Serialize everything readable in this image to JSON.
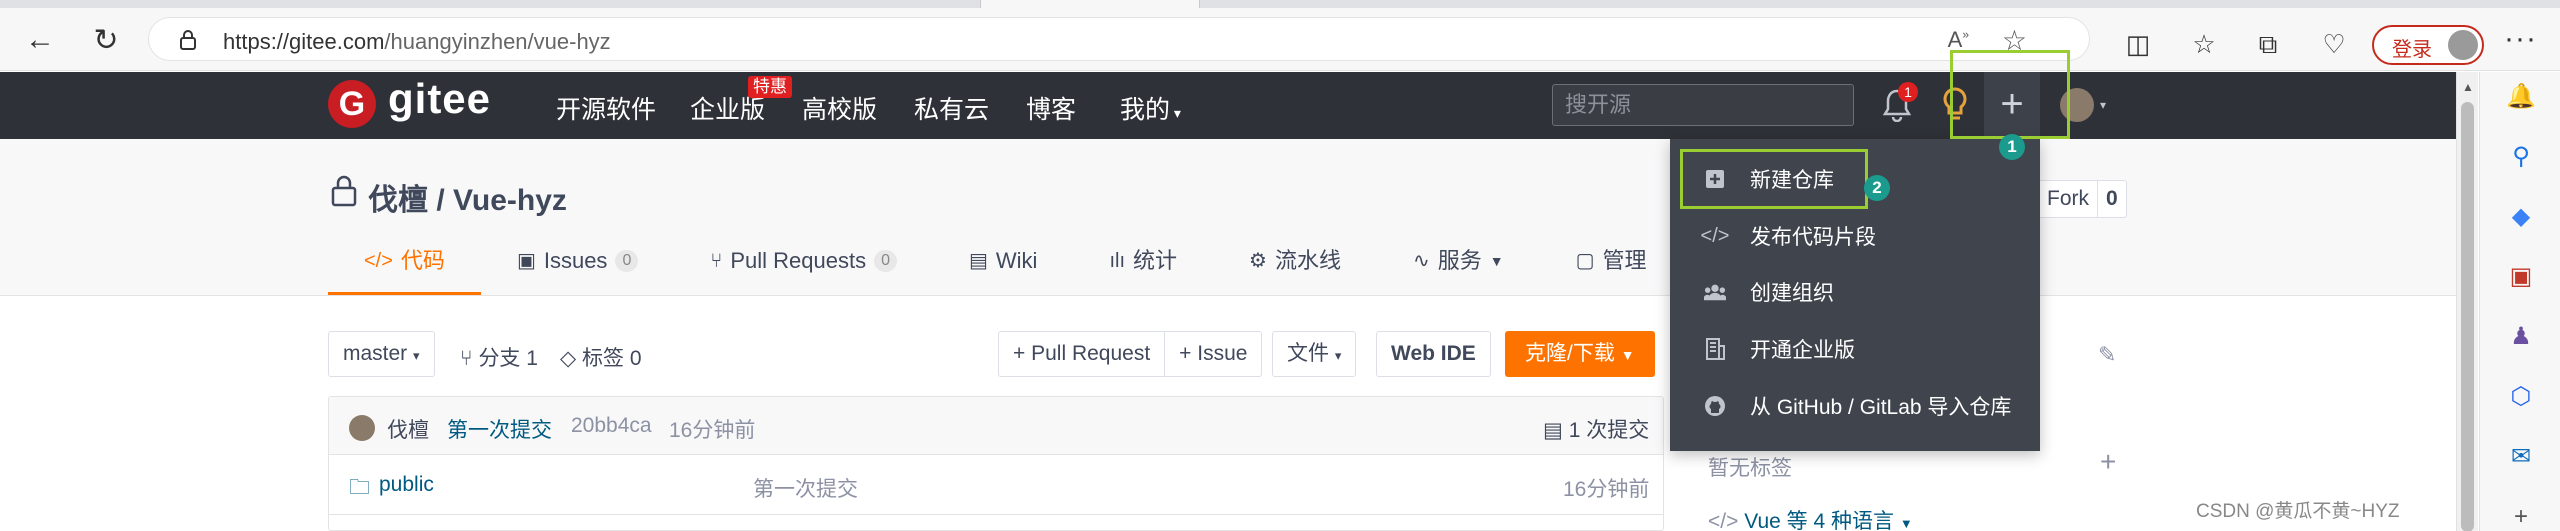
{
  "browser": {
    "url_host": "https://gitee.com",
    "url_path": "/huangyinzhen/vue-hyz",
    "login_label": "登录",
    "more_label": "···"
  },
  "header": {
    "logo_mark": "G",
    "logo_text": "gitee",
    "nav": [
      "开源软件",
      "企业版",
      "高校版",
      "私有云",
      "博客",
      "我的"
    ],
    "special_badge": "特惠",
    "search_placeholder": "搜开源",
    "notification_count": "1",
    "plus_symbol": "+"
  },
  "annotations": {
    "step1": "1",
    "step2": "2",
    "highlight_color": "#9acd32",
    "step_color": "#1a9b8d"
  },
  "dropdown": {
    "items": [
      "新建仓库",
      "发布代码片段",
      "创建组织",
      "开通企业版",
      "从 GitHub / GitLab 导入仓库"
    ]
  },
  "repo": {
    "title": "伐檀 / Vue-hyz",
    "fork_label": "Fork",
    "fork_count": "0",
    "tabs": [
      {
        "icon": "</>",
        "label": "代码"
      },
      {
        "icon": "▣",
        "label": "Issues",
        "count": "0"
      },
      {
        "icon": "⑂",
        "label": "Pull Requests",
        "count": "0"
      },
      {
        "icon": "▤",
        "label": "Wiki"
      },
      {
        "icon": "ılı",
        "label": "统计"
      },
      {
        "icon": "⚙",
        "label": "流水线"
      },
      {
        "icon": "∿",
        "label": "服务"
      },
      {
        "icon": "▢",
        "label": "管理"
      }
    ],
    "accent_color": "#fe7300"
  },
  "toolbar": {
    "branch": "master",
    "branches": "分支 1",
    "tags": "标签 0",
    "pull_request": "+ Pull Request",
    "issue": "+ Issue",
    "file": "文件",
    "web_ide": "Web IDE",
    "clone": "克隆/下载"
  },
  "commit": {
    "author": "伐檀",
    "message": "第一次提交",
    "hash": "20bb4ca",
    "time": "16分钟前",
    "count": "1 次提交"
  },
  "files": [
    {
      "name": "public",
      "message": "第一次提交",
      "time": "16分钟前"
    }
  ],
  "sidebar": {
    "no_tags": "暂无标签",
    "add": "+",
    "lang_prefix": "</>",
    "lang": "Vue",
    "lang_rest": "等 4 种语言"
  },
  "watermark": "CSDN @黄瓜不黄~HYZ"
}
